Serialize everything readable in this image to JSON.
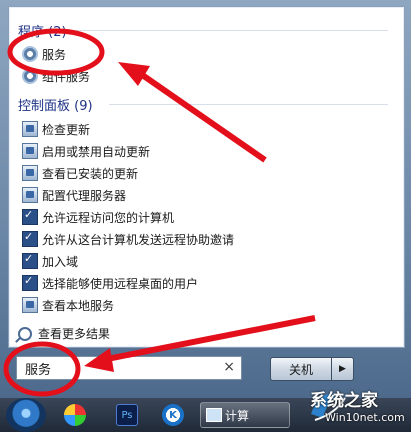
{
  "start_menu": {
    "programs_title": "程序 (2)",
    "programs": [
      {
        "label": "服务",
        "icon": "gear-icon"
      },
      {
        "label": "组件服务",
        "icon": "gear-icon"
      }
    ],
    "control_panel_title": "控制面板 (9)",
    "control_panel": [
      {
        "label": "检查更新",
        "icon": "control-panel-icon"
      },
      {
        "label": "启用或禁用自动更新",
        "icon": "control-panel-icon"
      },
      {
        "label": "查看已安装的更新",
        "icon": "control-panel-icon"
      },
      {
        "label": "配置代理服务器",
        "icon": "control-panel-icon"
      },
      {
        "label": "允许远程访问您的计算机",
        "icon": "monitor-icon"
      },
      {
        "label": "允许从这台计算机发送远程协助邀请",
        "icon": "monitor-icon"
      },
      {
        "label": "加入域",
        "icon": "monitor-icon"
      },
      {
        "label": "选择能够使用远程桌面的用户",
        "icon": "monitor-icon"
      },
      {
        "label": "查看本地服务",
        "icon": "control-panel-icon"
      }
    ],
    "more_results": "查看更多结果"
  },
  "search": {
    "value": "服务",
    "clear": "×"
  },
  "shutdown": {
    "label": "关机",
    "arrow": "▶"
  },
  "taskbar": {
    "items": [
      {
        "icon": "windows-orb-icon"
      },
      {
        "icon": "colorful-app-icon"
      },
      {
        "icon": "photoshop-icon",
        "text": "Ps"
      },
      {
        "icon": "k-app-icon",
        "text": "K"
      },
      {
        "icon": "computer-icon",
        "text": "计算"
      }
    ]
  },
  "watermark": {
    "title": "系统之家",
    "subtitle": "Win10net.com"
  },
  "colors": {
    "section_title": "#1e3287",
    "annotation": "#e3101b"
  }
}
